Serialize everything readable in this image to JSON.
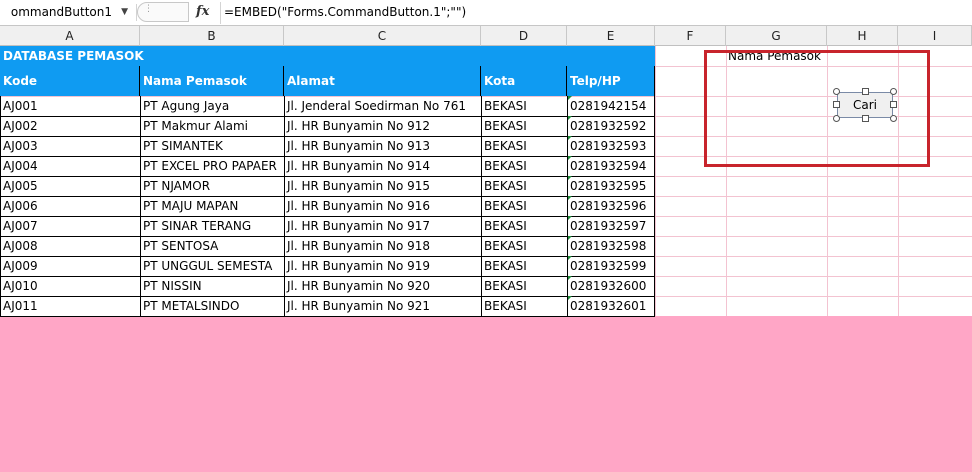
{
  "formula_bar": {
    "name_box": "ommandButton1",
    "fx_label": "fx",
    "formula": "=EMBED(\"Forms.CommandButton.1\";\"\")"
  },
  "columns": [
    "A",
    "B",
    "C",
    "D",
    "E",
    "F",
    "G",
    "H",
    "I"
  ],
  "table": {
    "title": "DATABASE PEMASOK",
    "headers": [
      "Kode",
      "Nama Pemasok",
      "Alamat",
      "Kota",
      "Telp/HP"
    ],
    "rows": [
      [
        "AJ001",
        "PT Agung Jaya",
        "Jl. Jenderal Soedirman No 761",
        "BEKASI",
        "0281942154"
      ],
      [
        "AJ002",
        "PT Makmur Alami",
        "Jl. HR Bunyamin No 912",
        "BEKASI",
        "0281932592"
      ],
      [
        "AJ003",
        "PT SIMANTEK",
        "Jl. HR Bunyamin No 913",
        "BEKASI",
        "0281932593"
      ],
      [
        "AJ004",
        "PT EXCEL PRO PAPAER",
        "Jl. HR Bunyamin No 914",
        "BEKASI",
        "0281932594"
      ],
      [
        "AJ005",
        "PT NJAMOR",
        "Jl. HR Bunyamin No 915",
        "BEKASI",
        "0281932595"
      ],
      [
        "AJ006",
        "PT MAJU MAPAN",
        "Jl. HR Bunyamin No 916",
        "BEKASI",
        "0281932596"
      ],
      [
        "AJ007",
        "PT SINAR TERANG",
        "Jl. HR Bunyamin No 917",
        "BEKASI",
        "0281932597"
      ],
      [
        "AJ008",
        "PT SENTOSA",
        "Jl. HR Bunyamin No 918",
        "BEKASI",
        "0281932598"
      ],
      [
        "AJ009",
        "PT UNGGUL SEMESTA",
        "Jl. HR Bunyamin No 919",
        "BEKASI",
        "0281932599"
      ],
      [
        "AJ010",
        "PT NISSIN",
        "Jl. HR Bunyamin No 920",
        "BEKASI",
        "0281932600"
      ],
      [
        "AJ011",
        "PT METALSINDO",
        "Jl. HR Bunyamin No 921",
        "BEKASI",
        "0281932601"
      ]
    ]
  },
  "search_panel": {
    "label": "Nama Pemasok",
    "button_label": "Cari"
  },
  "colors": {
    "header_fill": "#0f9bf2",
    "highlight_frame": "#c8242c",
    "background": "#ffa6c6"
  }
}
